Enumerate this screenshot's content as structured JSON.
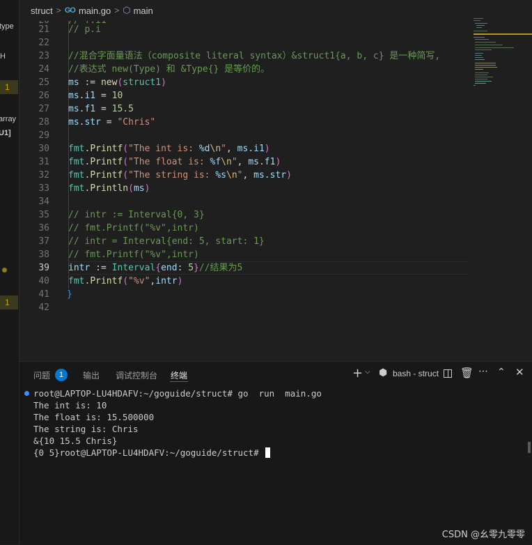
{
  "sidebar": {
    "fragments": [
      "type",
      "H",
      "1",
      "array",
      "U1]",
      "1"
    ]
  },
  "breadcrumb": {
    "folder": "struct",
    "file": "main.go",
    "symbol": "main"
  },
  "editor": {
    "partial_top": "// f.i1",
    "lines": [
      {
        "n": "21",
        "text": "// p.i"
      },
      {
        "n": "22",
        "text": ""
      },
      {
        "n": "23",
        "text": "//混合字面量语法（composite literal syntax）&struct1{a, b, c} 是一种简写,"
      },
      {
        "n": "24",
        "text": "//表达式 new(Type) 和 &Type{} 是等价的。"
      },
      {
        "n": "25",
        "text": "ms := new(struct1)"
      },
      {
        "n": "26",
        "text": "ms.i1 = 10"
      },
      {
        "n": "27",
        "text": "ms.f1 = 15.5"
      },
      {
        "n": "28",
        "text": "ms.str = \"Chris\""
      },
      {
        "n": "29",
        "text": ""
      },
      {
        "n": "30",
        "text": "fmt.Printf(\"The int is: %d\\n\", ms.i1)"
      },
      {
        "n": "31",
        "text": "fmt.Printf(\"The float is: %f\\n\", ms.f1)"
      },
      {
        "n": "32",
        "text": "fmt.Printf(\"The string is: %s\\n\", ms.str)"
      },
      {
        "n": "33",
        "text": "fmt.Println(ms)"
      },
      {
        "n": "34",
        "text": ""
      },
      {
        "n": "35",
        "text": "// intr := Interval{0, 3}"
      },
      {
        "n": "36",
        "text": "// fmt.Printf(\"%v\",intr)"
      },
      {
        "n": "37",
        "text": "// intr = Interval{end: 5, start: 1}"
      },
      {
        "n": "38",
        "text": "// fmt.Printf(\"%v\",intr)"
      },
      {
        "n": "39",
        "text": "intr := Interval{end: 5}//结果为5"
      },
      {
        "n": "40",
        "text": "fmt.Printf(\"%v\",intr)"
      },
      {
        "n": "41",
        "text": "}"
      },
      {
        "n": "42",
        "text": ""
      }
    ],
    "active_line": "39"
  },
  "panel": {
    "tabs": [
      {
        "label": "问题",
        "badge": "1"
      },
      {
        "label": "输出"
      },
      {
        "label": "调试控制台"
      },
      {
        "label": "终端",
        "active": true
      }
    ],
    "terminal_name": "bash - struct",
    "icons": [
      "plus-icon",
      "chevron-down-icon",
      "terminal-icon",
      "split-icon",
      "trash-icon",
      "more-icon",
      "chevron-up-icon",
      "close-icon"
    ],
    "terminal_lines": [
      "root@LAPTOP-LU4HDAFV:~/goguide/struct# go  run  main.go",
      "The int is: 10",
      "The float is: 15.500000",
      "The string is: Chris",
      "&{10 15.5 Chris}",
      "{0 5}root@LAPTOP-LU4HDAFV:~/goguide/struct# "
    ]
  },
  "watermark": "CSDN @幺零九零零",
  "colors": {
    "background": "#1f1f1f",
    "comment": "#6a9955",
    "variable": "#9cdcfe",
    "function": "#dcdcaa",
    "string": "#ce9178",
    "type": "#4ec9b0",
    "accent": "#0078d4"
  }
}
